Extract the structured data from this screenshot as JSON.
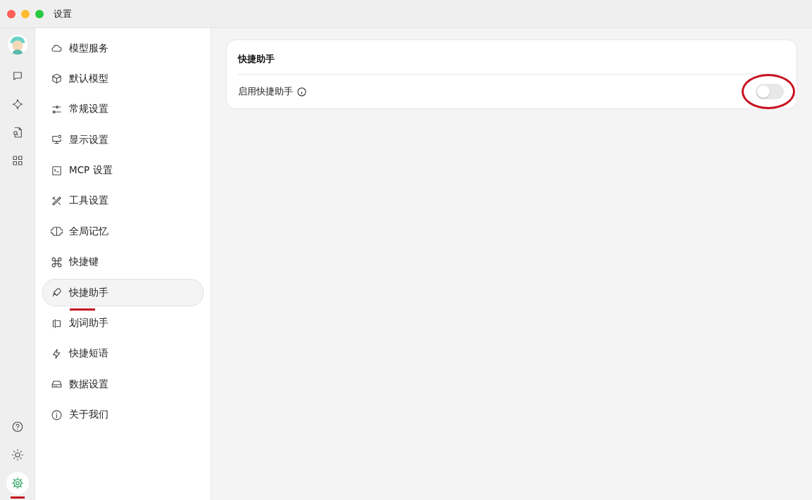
{
  "window": {
    "title": "设置"
  },
  "rail": {
    "top": [
      {
        "selected": false
      },
      {
        "selected": false
      },
      {
        "selected": false
      },
      {
        "selected": false
      }
    ],
    "bottom": [
      {
        "selected": false
      },
      {
        "selected": false
      },
      {
        "selected": true
      }
    ]
  },
  "sidebar": {
    "items": [
      {
        "label": "模型服务",
        "selected": false
      },
      {
        "label": "默认模型",
        "selected": false
      },
      {
        "label": "常规设置",
        "selected": false
      },
      {
        "label": "显示设置",
        "selected": false
      },
      {
        "label": "MCP 设置",
        "selected": false
      },
      {
        "label": "工具设置",
        "selected": false
      },
      {
        "label": "全局记忆",
        "selected": false
      },
      {
        "label": "快捷键",
        "selected": false
      },
      {
        "label": "快捷助手",
        "selected": true
      },
      {
        "label": "划词助手",
        "selected": false
      },
      {
        "label": "快捷短语",
        "selected": false
      },
      {
        "label": "数据设置",
        "selected": false
      },
      {
        "label": "关于我们",
        "selected": false
      }
    ]
  },
  "panel": {
    "title": "快捷助手",
    "setting": {
      "label": "启用快捷助手",
      "on": false
    }
  }
}
